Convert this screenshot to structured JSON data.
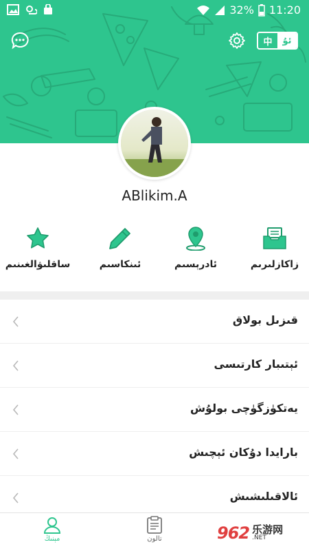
{
  "status_bar": {
    "battery": "32%",
    "time": "11:20"
  },
  "header": {
    "lang_options": [
      "中",
      "ئۇ"
    ],
    "colors": {
      "brand": "#2ec58e",
      "doodle": "#27a877"
    }
  },
  "profile": {
    "username": "ABlikim.A"
  },
  "quick_actions": [
    {
      "label": "زاكازلىرىم",
      "icon": "order-box-icon"
    },
    {
      "label": "ئادرېسىم",
      "icon": "location-pin-icon"
    },
    {
      "label": "ئىنكاسىم",
      "icon": "pencil-icon"
    },
    {
      "label": "ساقلىۋالغىنىم",
      "icon": "star-icon"
    }
  ],
  "menu_items": [
    {
      "label": "قىزىل بولاق"
    },
    {
      "label": "ئېتىبار كارتىسى"
    },
    {
      "label": "يەتكۈزگۈچى بولۇش"
    },
    {
      "label": "بارايدا دۇكان ئېچىش"
    },
    {
      "label": "ئالاقىلىشىش"
    }
  ],
  "bottom_nav": [
    {
      "label": "مېنىڭ",
      "icon": "person-icon",
      "active": true
    },
    {
      "label": "تالون",
      "icon": "clipboard-icon",
      "active": false
    }
  ],
  "watermark": {
    "number": "962",
    "suffix": ".NET",
    "cn": "乐游网"
  }
}
